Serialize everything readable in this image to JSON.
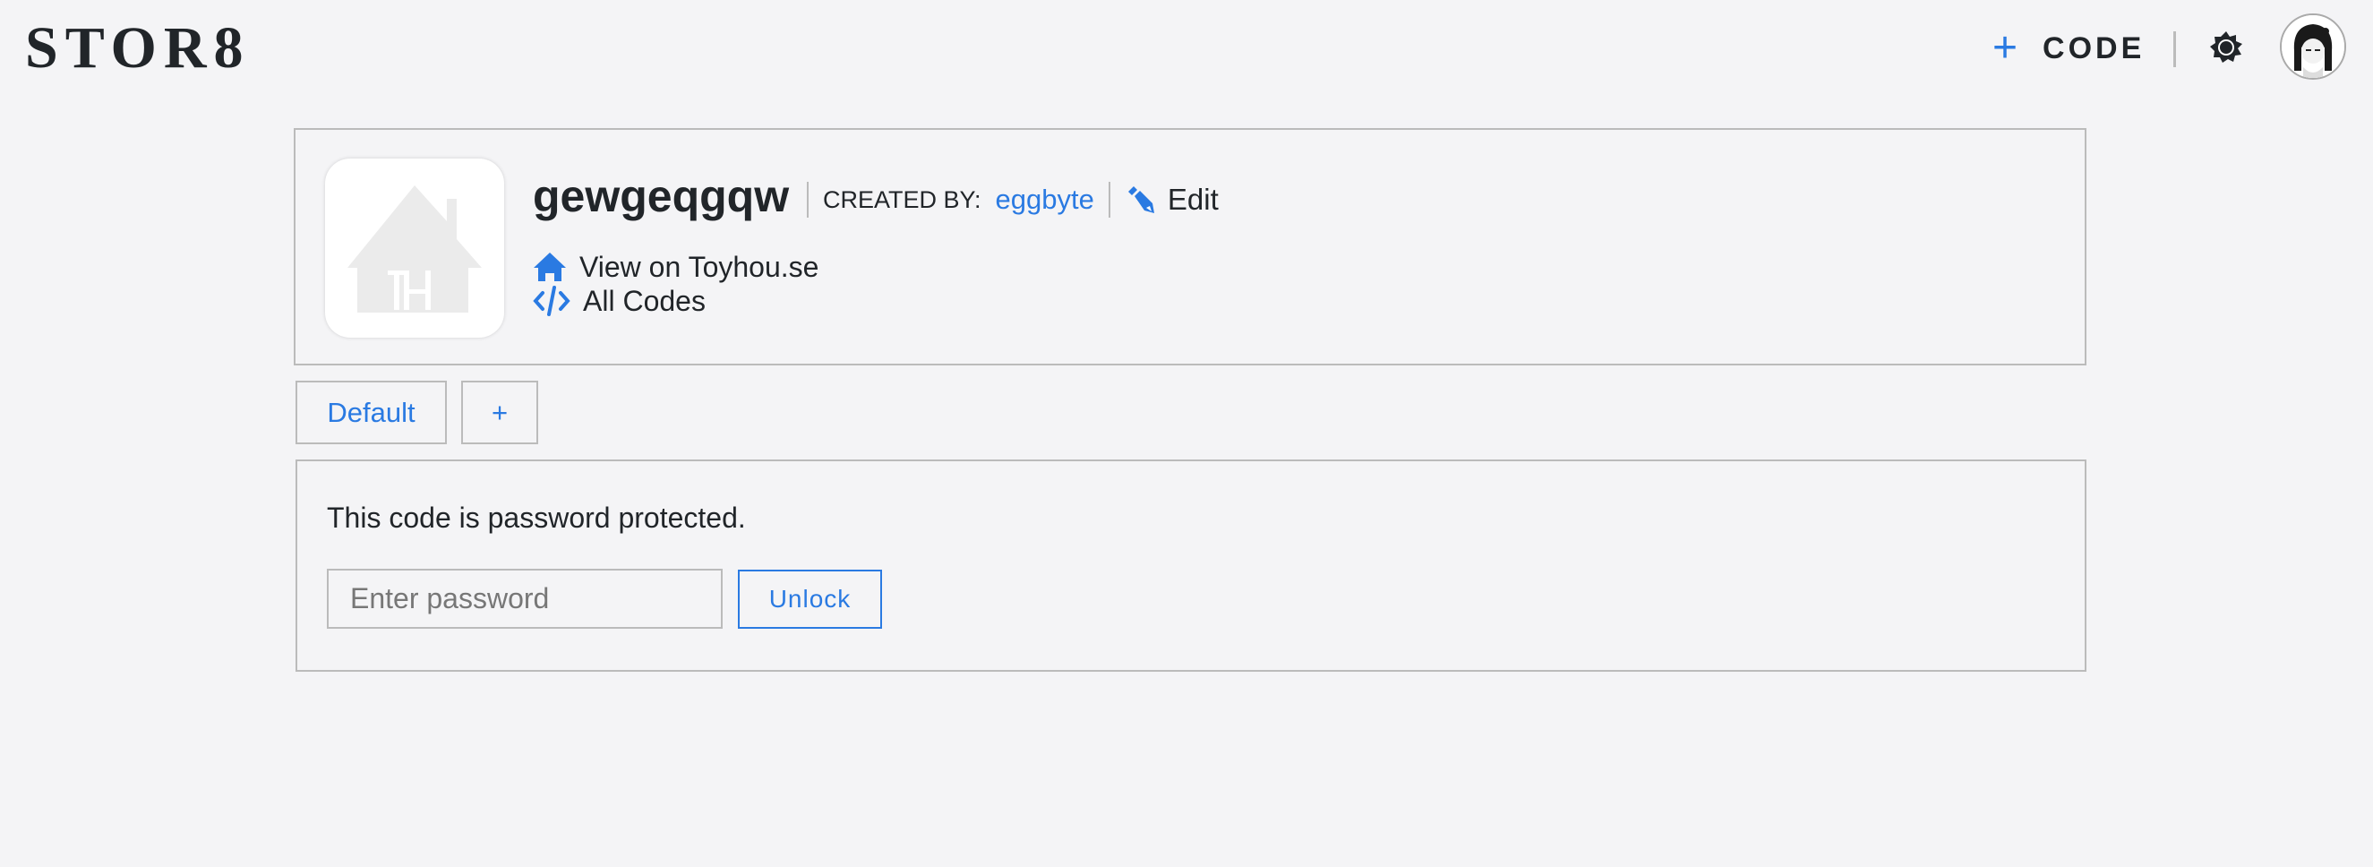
{
  "header": {
    "logo": "STOR8",
    "add_code_label": "CODE",
    "add_code_icon": "plus-icon",
    "theme_icon": "gear-icon",
    "avatar_icon": "user-avatar"
  },
  "code": {
    "title": "gewgeqgqw",
    "created_by_label": "CREATED BY:",
    "author": "eggbyte",
    "edit_label": "Edit",
    "thumbnail_text": "TH",
    "links": [
      {
        "label": "View on Toyhou.se",
        "icon": "home-icon"
      },
      {
        "label": "All Codes",
        "icon": "code-icon"
      }
    ]
  },
  "tabs": [
    {
      "label": "Default"
    },
    {
      "label": "+"
    }
  ],
  "protected": {
    "message": "This code is password protected.",
    "password_placeholder": "Enter password",
    "password_value": "",
    "unlock_label": "Unlock"
  },
  "colors": {
    "accent": "#2a7ae2",
    "background": "#f4f4f6",
    "border": "#bbbbbb",
    "text": "#212529"
  }
}
